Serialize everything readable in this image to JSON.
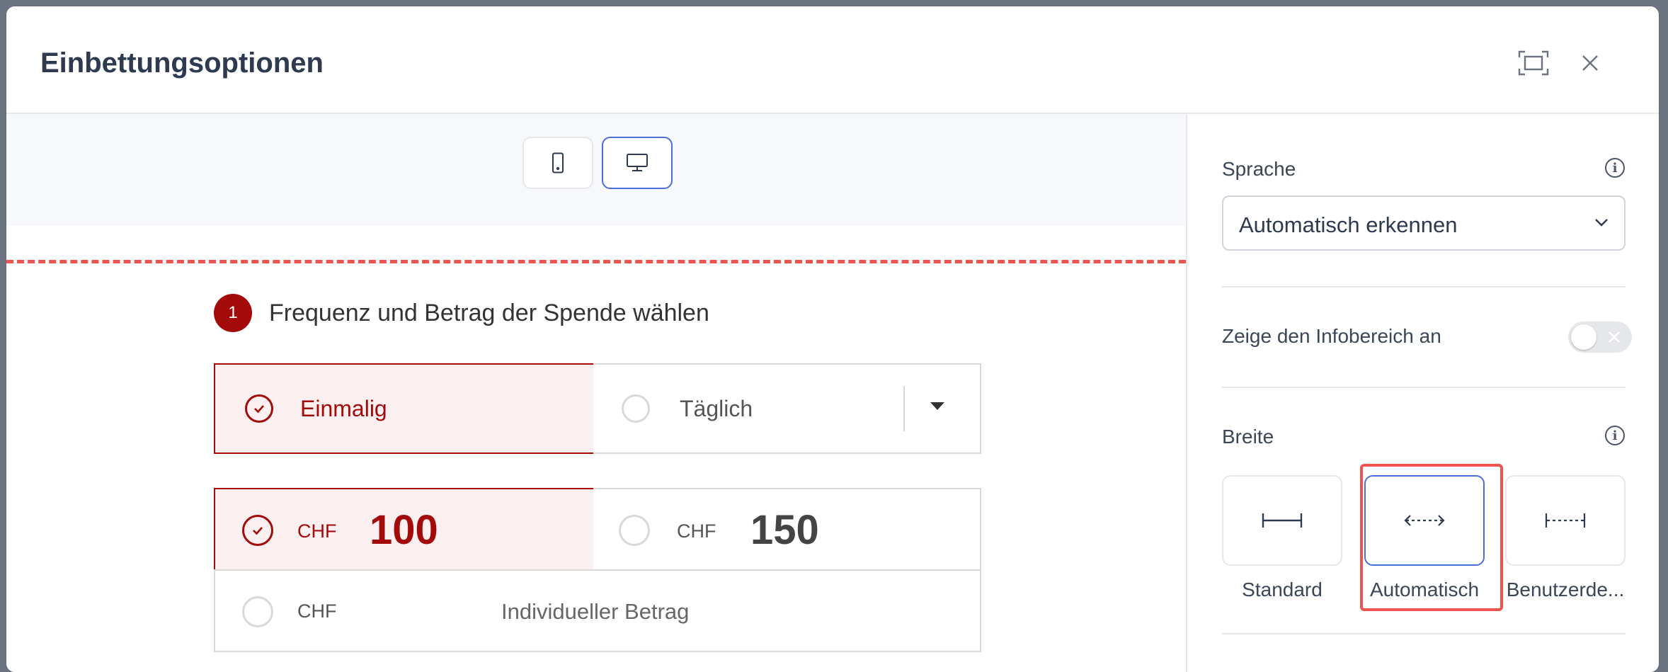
{
  "dialog": {
    "title": "Einbettungsoptionen"
  },
  "preview": {
    "step_number": "1",
    "step_title": "Frequenz und Betrag der Spende wählen",
    "frequency": {
      "selected": "Einmalig",
      "other": "Täglich"
    },
    "amounts": {
      "currency": "CHF",
      "selected_amount": "100",
      "other_amount": "150",
      "custom_placeholder": "Individueller Betrag"
    }
  },
  "settings": {
    "language": {
      "label": "Sprache",
      "value": "Automatisch erkennen"
    },
    "info_area": {
      "label": "Zeige den Infobereich an",
      "enabled": false
    },
    "width": {
      "label": "Breite",
      "options": [
        {
          "label": "Standard"
        },
        {
          "label": "Automatisch"
        },
        {
          "label": "Benutzerde..."
        }
      ],
      "selected": "Automatisch"
    }
  },
  "colors": {
    "accent": "#a30b0b",
    "selection_blue": "#4a6fd8",
    "highlight_red": "#ef5350"
  },
  "icons": [
    "expand-icon",
    "close-icon",
    "mobile-icon",
    "desktop-icon",
    "chevron-down-icon",
    "info-icon",
    "check-icon",
    "caret-down-icon",
    "width-standard-icon",
    "width-auto-icon",
    "width-custom-icon",
    "toggle-x-icon"
  ]
}
